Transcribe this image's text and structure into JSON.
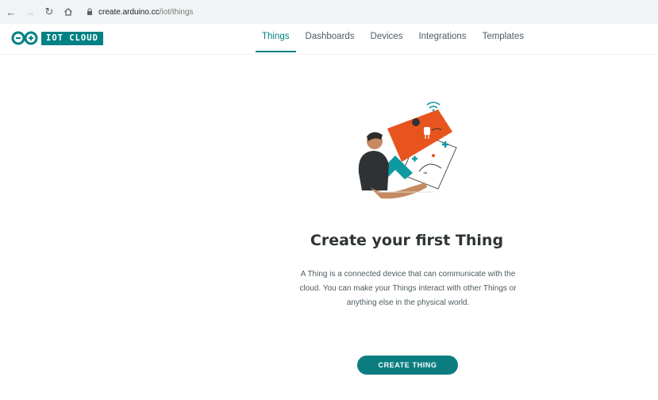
{
  "browser": {
    "url_host": "create.arduino.cc",
    "url_path": "/iot/things",
    "icons": {
      "back": "arrow-left-icon",
      "forward": "arrow-right-icon",
      "reload": "reload-icon",
      "home": "home-icon",
      "lock": "lock-icon"
    }
  },
  "header": {
    "logo_text": "IOT CLOUD",
    "brand_color": "#008184",
    "nav": [
      {
        "label": "Things",
        "active": true
      },
      {
        "label": "Dashboards",
        "active": false
      },
      {
        "label": "Devices",
        "active": false
      },
      {
        "label": "Integrations",
        "active": false
      },
      {
        "label": "Templates",
        "active": false
      }
    ]
  },
  "main": {
    "title": "Create your first Thing",
    "description": "A Thing is a connected device that can communicate with the cloud. You can make your Things interact with other Things or anything else in the physical world.",
    "cta_label": "CREATE THING"
  },
  "colors": {
    "accent": "#008184",
    "illustration_orange": "#e8541e",
    "illustration_teal": "#0e9aa0"
  }
}
